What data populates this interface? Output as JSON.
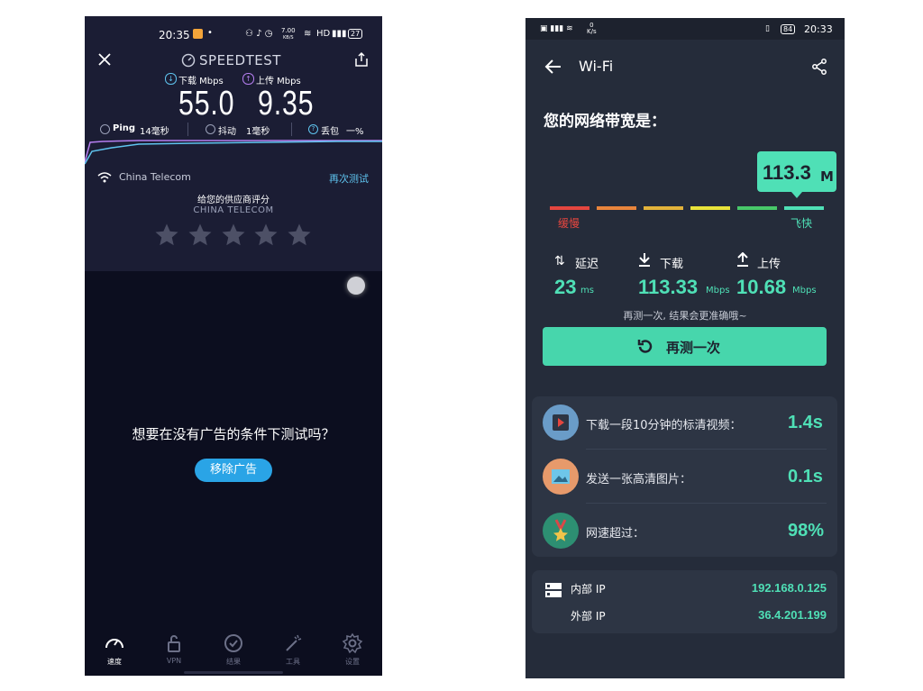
{
  "left": {
    "status": {
      "time": "20:35",
      "net_speed": "7.00",
      "net_unit": "KB/S",
      "hd": "HD",
      "battery": "27"
    },
    "app_title": "SPEEDTEST",
    "download_label": "下载 Mbps",
    "upload_label": "上传 Mbps",
    "download_value": "55.0",
    "upload_value": "9.35",
    "ping_label": "Ping",
    "ping_value": "14毫秒",
    "jitter_label": "抖动",
    "jitter_value": "1毫秒",
    "loss_label": "丢包",
    "loss_value": "一%",
    "provider": "China Telecom",
    "retest": "再次测试",
    "rate_prompt": "给您的供应商评分",
    "rate_provider": "CHINA TELECOM",
    "stars": 5,
    "ad_question": "想要在没有广告的条件下测试吗？",
    "remove_ads": "移除广告",
    "tabs": [
      {
        "label": "速度",
        "icon": "speedometer-icon",
        "active": true
      },
      {
        "label": "VPN",
        "icon": "lock-icon",
        "active": false
      },
      {
        "label": "结果",
        "icon": "check-circle-icon",
        "active": false
      },
      {
        "label": "工具",
        "icon": "magic-wand-icon",
        "active": false
      },
      {
        "label": "设置",
        "icon": "gear-icon",
        "active": false
      }
    ]
  },
  "right": {
    "status": {
      "time": "20:33",
      "battery": "84",
      "net_speed": "0",
      "net_unit": "K/s"
    },
    "title": "Wi-Fi",
    "headline": "您的网络带宽是：",
    "speed_badge": "113.3",
    "speed_badge_unit": "M",
    "slow_label": "缓慢",
    "fast_label": "飞快",
    "bar_colors": [
      "#e5463f",
      "#e9853c",
      "#e3b33a",
      "#e9e33a",
      "#48c869",
      "#4fe0b6"
    ],
    "latency_label": "延迟",
    "latency_value": "23",
    "latency_unit": "ms",
    "download_label": "下载",
    "download_value": "113.33",
    "download_unit": "Mbps",
    "upload_label": "上传",
    "upload_value": "10.68",
    "upload_unit": "Mbps",
    "hint": "再测一次, 结果会更准确哦~",
    "retest_button": "再测一次",
    "rows": [
      {
        "label": "下载一段10分钟的标清视频：",
        "value": "1.4s",
        "icon": "video-icon"
      },
      {
        "label": "发送一张高清图片：",
        "value": "0.1s",
        "icon": "image-icon"
      },
      {
        "label": "网速超过：",
        "value": "98%",
        "icon": "medal-icon"
      }
    ],
    "internal_ip_label": "内部 IP",
    "internal_ip": "192.168.0.125",
    "external_ip_label": "外部 IP",
    "external_ip": "36.4.201.199"
  }
}
